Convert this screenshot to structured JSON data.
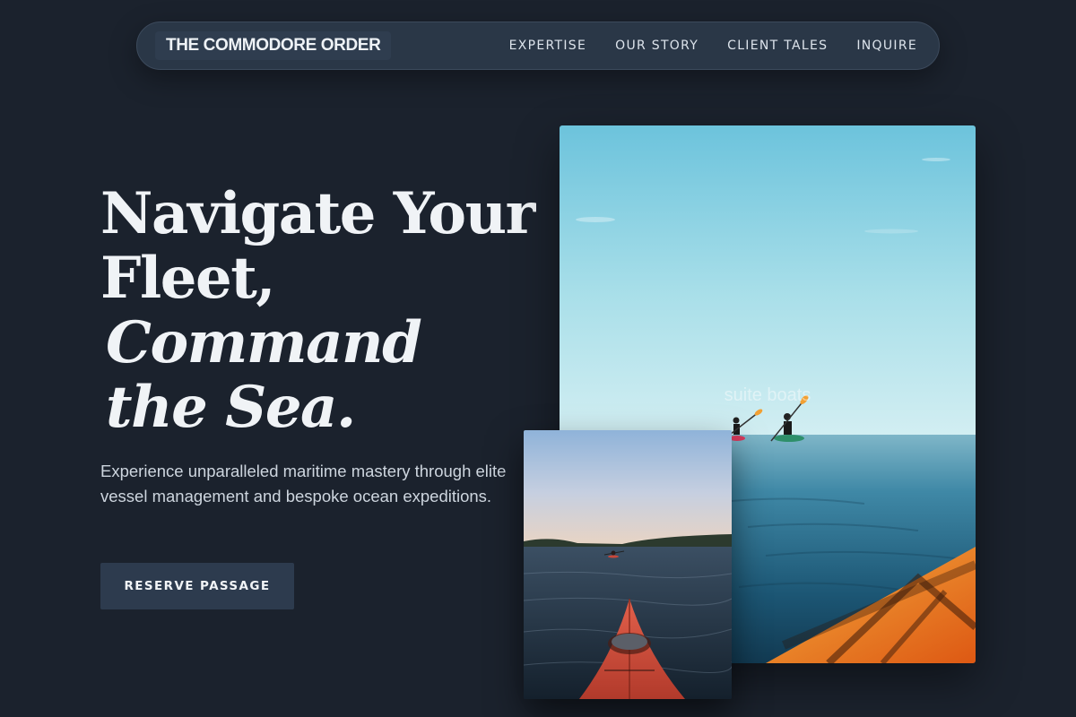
{
  "brand": {
    "name": "THE COMMODORE ORDER"
  },
  "nav": {
    "links": [
      {
        "label": "EXPERTISE"
      },
      {
        "label": "OUR STORY"
      },
      {
        "label": "CLIENT TALES"
      },
      {
        "label": "INQUIRE"
      }
    ]
  },
  "hero": {
    "headline_line1": "Navigate Your",
    "headline_line2": "Fleet,",
    "headline_line3": "Command",
    "headline_line4": "the Sea.",
    "subtext": "Experience unparalleled maritime mastery through elite vessel management and bespoke ocean expeditions.",
    "cta_label": "RESERVE PASSAGE"
  },
  "images": {
    "main_alt_text": "suite boats",
    "main_subject": "kayakers paddling on calm sea under clear sky",
    "small_subject": "red kayak bow on open water at dusk"
  },
  "colors": {
    "background": "#1b222d",
    "nav_background": "#2a3747",
    "button_background": "#2d3b4e",
    "text": "#f0f3f6"
  }
}
